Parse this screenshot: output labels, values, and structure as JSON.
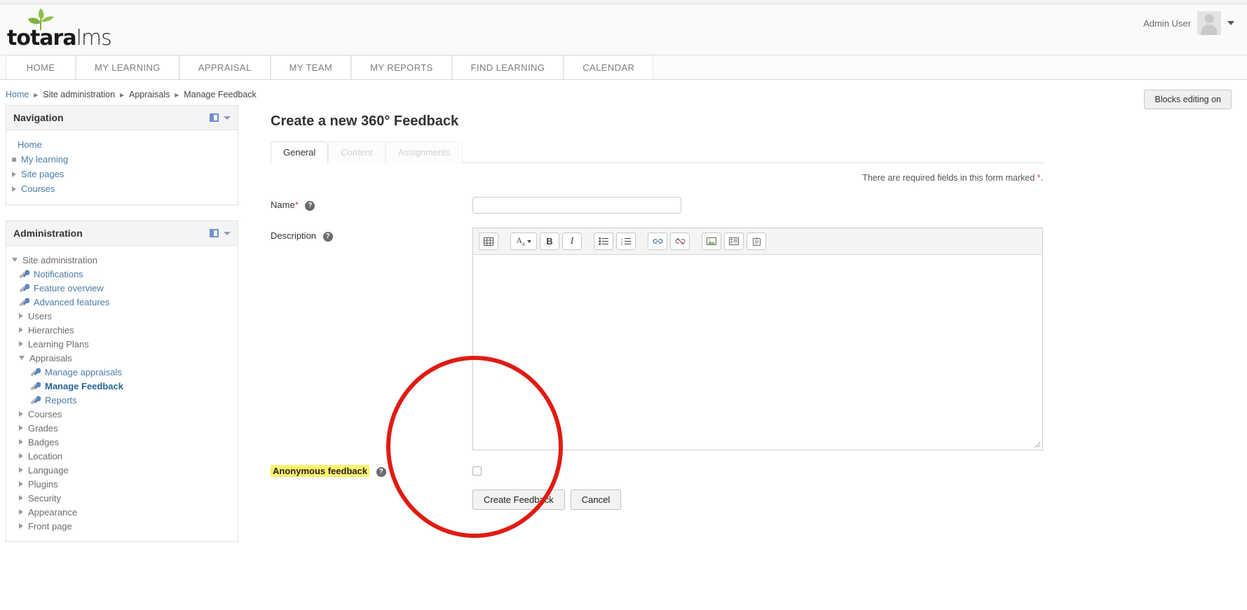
{
  "header": {
    "logo_brand_bold": "totara",
    "logo_brand_light": "lms",
    "user_name": "Admin User",
    "avatar_icon": "user-avatar-icon",
    "caret_icon": "chevron-down-icon"
  },
  "nav_tabs": [
    {
      "label": "HOME"
    },
    {
      "label": "MY LEARNING"
    },
    {
      "label": "APPRAISAL"
    },
    {
      "label": "MY TEAM"
    },
    {
      "label": "MY REPORTS"
    },
    {
      "label": "FIND LEARNING"
    },
    {
      "label": "CALENDAR"
    }
  ],
  "breadcrumb": {
    "items": [
      {
        "label": "Home",
        "link": true
      },
      {
        "label": "Site administration",
        "link": false
      },
      {
        "label": "Appraisals",
        "link": false
      },
      {
        "label": "Manage Feedback",
        "link": false
      }
    ],
    "separator": "►"
  },
  "blocks_editing": {
    "label": "Blocks editing on"
  },
  "navigation_block": {
    "title": "Navigation",
    "dock_icon": "dock-block-icon",
    "collapse_icon": "chevron-down-icon",
    "items": [
      {
        "label": "Home",
        "icon": "none",
        "level": 0
      },
      {
        "label": "My learning",
        "icon": "bullet",
        "level": 1
      },
      {
        "label": "Site pages",
        "icon": "expand-arrow",
        "level": 1
      },
      {
        "label": "Courses",
        "icon": "expand-arrow",
        "level": 1
      }
    ]
  },
  "administration_block": {
    "title": "Administration",
    "dock_icon": "dock-block-icon",
    "collapse_icon": "chevron-down-icon",
    "items": [
      {
        "label": "Site administration",
        "icon": "collapse-arrow",
        "level": 0,
        "link": false,
        "current": false
      },
      {
        "label": "Notifications",
        "icon": "wrench",
        "level": 1,
        "link": true,
        "current": false
      },
      {
        "label": "Feature overview",
        "icon": "wrench",
        "level": 1,
        "link": true,
        "current": false
      },
      {
        "label": "Advanced features",
        "icon": "wrench",
        "level": 1,
        "link": true,
        "current": false
      },
      {
        "label": "Users",
        "icon": "expand-arrow",
        "level": 1,
        "link": false,
        "current": false
      },
      {
        "label": "Hierarchies",
        "icon": "expand-arrow",
        "level": 1,
        "link": false,
        "current": false
      },
      {
        "label": "Learning Plans",
        "icon": "expand-arrow",
        "level": 1,
        "link": false,
        "current": false
      },
      {
        "label": "Appraisals",
        "icon": "collapse-arrow",
        "level": 1,
        "link": false,
        "current": false
      },
      {
        "label": "Manage appraisals",
        "icon": "wrench",
        "level": 2,
        "link": true,
        "current": false
      },
      {
        "label": "Manage Feedback",
        "icon": "wrench",
        "level": 2,
        "link": true,
        "current": true
      },
      {
        "label": "Reports",
        "icon": "wrench",
        "level": 2,
        "link": true,
        "current": false
      },
      {
        "label": "Courses",
        "icon": "expand-arrow",
        "level": 1,
        "link": false,
        "current": false
      },
      {
        "label": "Grades",
        "icon": "expand-arrow",
        "level": 1,
        "link": false,
        "current": false
      },
      {
        "label": "Badges",
        "icon": "expand-arrow",
        "level": 1,
        "link": false,
        "current": false
      },
      {
        "label": "Location",
        "icon": "expand-arrow",
        "level": 1,
        "link": false,
        "current": false
      },
      {
        "label": "Language",
        "icon": "expand-arrow",
        "level": 1,
        "link": false,
        "current": false
      },
      {
        "label": "Plugins",
        "icon": "expand-arrow",
        "level": 1,
        "link": false,
        "current": false
      },
      {
        "label": "Security",
        "icon": "expand-arrow",
        "level": 1,
        "link": false,
        "current": false
      },
      {
        "label": "Appearance",
        "icon": "expand-arrow",
        "level": 1,
        "link": false,
        "current": false
      },
      {
        "label": "Front page",
        "icon": "expand-arrow",
        "level": 1,
        "link": false,
        "current": false
      }
    ]
  },
  "main": {
    "page_title": "Create a new 360° Feedback",
    "tabs": [
      {
        "label": "General",
        "state": "active"
      },
      {
        "label": "Content",
        "state": "disabled"
      },
      {
        "label": "Assignments",
        "state": "disabled"
      }
    ],
    "required_note_text": "There are required fields in this form marked ",
    "required_note_star": "*",
    "required_note_end": ".",
    "fields": {
      "name": {
        "label": "Name",
        "required_marker": "*",
        "help_icon": "help-question-icon",
        "value": "",
        "placeholder": ""
      },
      "description": {
        "label": "Description",
        "help_icon": "help-question-icon",
        "value": ""
      },
      "anonymous": {
        "label": "Anonymous feedback",
        "help_icon": "help-question-icon",
        "checked": false,
        "highlighted": true,
        "highlight_color": "#fdf36a"
      }
    },
    "editor_toolbar": [
      {
        "name": "table-icon",
        "glyph": "⌸"
      },
      {
        "name": "font-style-icon",
        "glyph": "A"
      },
      {
        "name": "bold-icon",
        "glyph": "B"
      },
      {
        "name": "italic-icon",
        "glyph": "I"
      },
      {
        "name": "bullet-list-icon",
        "glyph": "≡"
      },
      {
        "name": "numbered-list-icon",
        "glyph": "≡"
      },
      {
        "name": "link-icon",
        "glyph": "🔗"
      },
      {
        "name": "unlink-icon",
        "glyph": "🔗"
      },
      {
        "name": "image-icon",
        "glyph": "⛰"
      },
      {
        "name": "media-icon",
        "glyph": "▣"
      },
      {
        "name": "paste-icon",
        "glyph": "📋"
      }
    ],
    "buttons": {
      "submit": "Create Feedback",
      "cancel": "Cancel"
    }
  },
  "annotation": {
    "type": "circle-highlight",
    "color": "#e01b12"
  }
}
